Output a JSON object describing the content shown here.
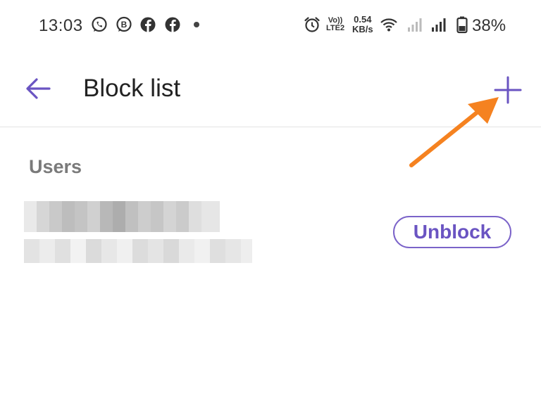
{
  "status_bar": {
    "time": "13:03",
    "notification_icons": [
      "whatsapp-icon",
      "whatsapp-business-icon",
      "facebook-icon",
      "facebook-icon"
    ],
    "volte_line1": "Vo))",
    "volte_line2": "LTE2",
    "net_speed_value": "0.54",
    "net_speed_unit": "KB/s",
    "battery_percent": "38%",
    "system_icons": [
      "alarm-icon",
      "wifi-icon",
      "signal-weak-icon",
      "signal-icon",
      "battery-icon"
    ]
  },
  "app_bar": {
    "title": "Block list",
    "back_icon": "arrow-left-icon",
    "add_icon": "plus-icon"
  },
  "users_section": {
    "heading": "Users",
    "blocked_users": [
      {
        "unblock_label": "Unblock"
      }
    ]
  },
  "annotation": {
    "arrow_color": "#f58220",
    "points_to": "add-button"
  },
  "colors": {
    "accent": "#6a54c2",
    "annotation_arrow": "#f58220",
    "section_heading": "#7a7a7a"
  }
}
